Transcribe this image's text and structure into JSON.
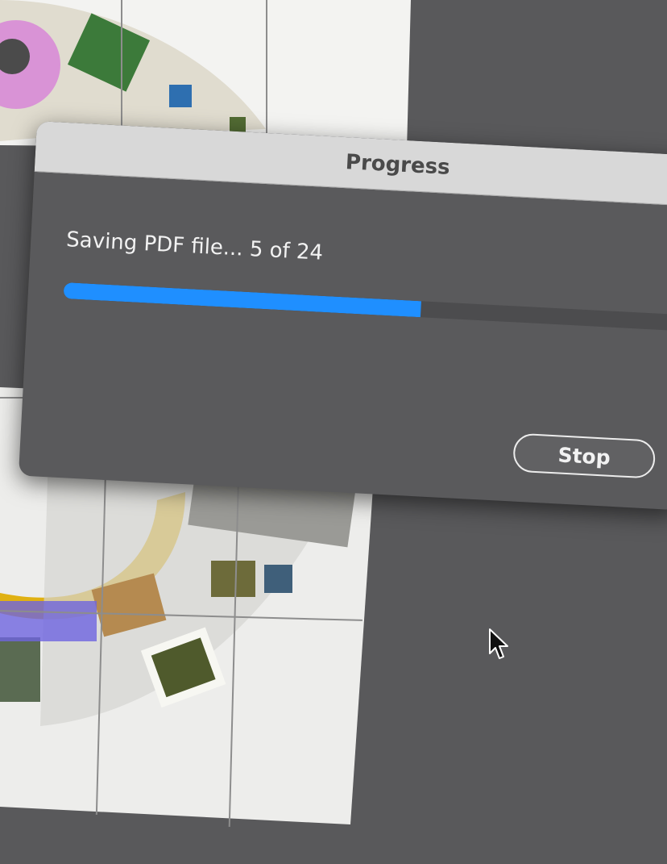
{
  "dialog": {
    "title": "Progress",
    "status_text": "Saving PDF file... 5 of 24",
    "progress": {
      "current": 5,
      "total": 24,
      "fraction": 0.555
    },
    "stop_label": "Stop"
  },
  "colors": {
    "desktop": "#59595b",
    "dialog_body": "#5a5a5c",
    "titlebar": "#d8d8d8",
    "progress_fill": "#1f8fff",
    "progress_track": "#4c4c4e"
  },
  "cursor": {
    "icon": "arrow-pointer-icon"
  }
}
